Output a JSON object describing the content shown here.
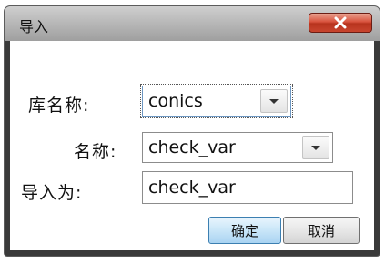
{
  "window": {
    "title": "导入",
    "close_icon": "close-icon",
    "accent_close": "#c8452f"
  },
  "form": {
    "library_label": "库名称:",
    "library_value": "conics",
    "name_label": "名称:",
    "name_value": "check_var",
    "import_as_label": "导入为:",
    "import_as_value": "check_var"
  },
  "buttons": {
    "ok_label": "确定",
    "cancel_label": "取消"
  }
}
